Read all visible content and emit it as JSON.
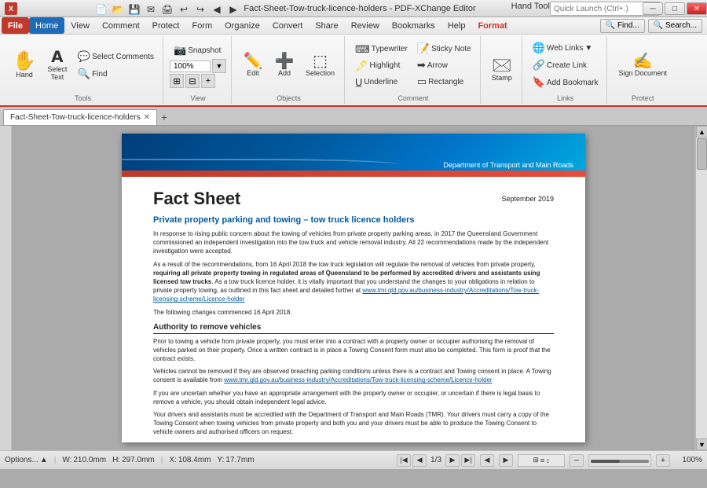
{
  "titlebar": {
    "title": "Fact-Sheet-Tow-truck-licence-holders - PDF-XChange Editor",
    "tool": "Hand Tool",
    "minimize": "─",
    "maximize": "□",
    "close": "✕"
  },
  "quickaccess": {
    "save": "💾",
    "undo": "↩",
    "redo": "↪",
    "open": "📁",
    "new": "📄"
  },
  "menu": {
    "items": [
      "File",
      "Home",
      "View",
      "Comment",
      "Protect",
      "Form",
      "Organize",
      "Convert",
      "Share",
      "Review",
      "Bookmarks",
      "Help",
      "Format"
    ]
  },
  "ribbon": {
    "active_tab": "Home",
    "tabs": [
      "File",
      "Home",
      "View",
      "Comment",
      "Protect",
      "Form",
      "Organize",
      "Convert",
      "Share",
      "Review",
      "Bookmarks",
      "Help",
      "Format"
    ],
    "groups": {
      "clipboard": {
        "label": "Tools",
        "hand_label": "Hand",
        "select_text_label": "Select\nText",
        "select_comments_label": "Select\nComments",
        "find_label": "Find"
      },
      "view": {
        "label": "View",
        "snapshot_label": "Snapshot",
        "zoom_label": "100%",
        "zoom_btn": "▼"
      },
      "objects": {
        "label": "Objects",
        "edit_label": "Edit",
        "add_label": "Add",
        "selection_label": "Selection"
      },
      "comment": {
        "label": "Comment",
        "typewriter_label": "Typewriter",
        "highlight_label": "Highlight",
        "underline_label": "Underline",
        "sticky_label": "Sticky Note",
        "arrow_label": "Arrow",
        "rectangle_label": "Rectangle"
      },
      "stamp": {
        "label": "",
        "stamp_label": "Stamp"
      },
      "links": {
        "label": "Links",
        "web_links_label": "Web Links",
        "create_link_label": "Create Link",
        "add_bookmark_label": "Add Bookmark"
      },
      "protect": {
        "label": "Protect",
        "sign_label": "Sign\nDocument"
      }
    }
  },
  "search": {
    "placeholder": "Quick Launch (Ctrl+.)",
    "find_placeholder": "Find..."
  },
  "doc_tab": {
    "name": "Fact-Sheet-Tow-truck-licence-holders",
    "active": true
  },
  "document": {
    "dept_name": "Department of Transport and Main Roads",
    "title": "Fact Sheet",
    "date": "September 2019",
    "subtitle": "Private property parking and towing – tow truck licence holders",
    "para1": "In response to rising public concern about the towing of vehicles from private property parking areas, in 2017 the Queensland Government commissioned an independent investigation into the tow truck and vehicle removal industry. All 22 recommendations made by the independent investigation were accepted.",
    "para2_prefix": "As a result of the recommendations, from 16 April 2018 the tow truck legislation will regulate the removal of vehicles from private property, ",
    "para2_bold": "requiring all private property towing in regulated areas of Queensland to be performed by accredited drivers and assistants using licensed tow trucks",
    "para2_suffix": ". As a tow truck licence holder, it is vitally important that you understand the changes to your obligations in relation to private property towing, as outlined in this fact sheet and detailed further at ",
    "para2_link": "www.tmr.qld.gov.au/business-industry/Accreditations/Tow-truck-licensing-scheme/Licence-holder",
    "para3": "The following changes commenced 16 April 2018.",
    "section1_title": "Authority to remove vehicles",
    "section1_para1": "Prior to towing a vehicle from private property, you must enter into a contract with a property owner or occupier authorising the removal of vehicles parked on their property. Once a written contract is in place a Towing Consent form must also be completed. This form is proof that the contract exists.",
    "section1_para2_prefix": "Vehicles cannot be removed if they are observed breaching parking conditions unless there is a contract and Towing consent in place. A Towing consent is available from ",
    "section1_para2_link": "www.tmr.qld.gov.au/business-industry/Accreditations/Tow-truck-licensing-scheme/Licence-holder",
    "section1_para3": "If you are uncertain whether you have an appropriate arrangement with the property owner or occupier, or uncertain if there is legal basis to remove a vehicle, you should obtain independent legal advice.",
    "section1_para4": "Your drivers and assistants must be accredited with the Department of Transport and Main Roads (TMR). Your drivers must carry a copy of the Towing Consent when towing vehicles from private property and both you and your drivers must be able to produce the Towing Consent to vehicle owners and authorised officers on request."
  },
  "statusbar": {
    "options": "Options...",
    "width_label": "W:",
    "width_val": "210.0mm",
    "height_label": "H:",
    "height_val": "297.0mm",
    "x_label": "X:",
    "x_val": "108.4mm",
    "y_label": "Y:",
    "y_val": "17.7mm",
    "page_current": "1",
    "page_total": "3",
    "zoom_level": "100%",
    "zoom_minus": "−",
    "zoom_plus": "+"
  }
}
